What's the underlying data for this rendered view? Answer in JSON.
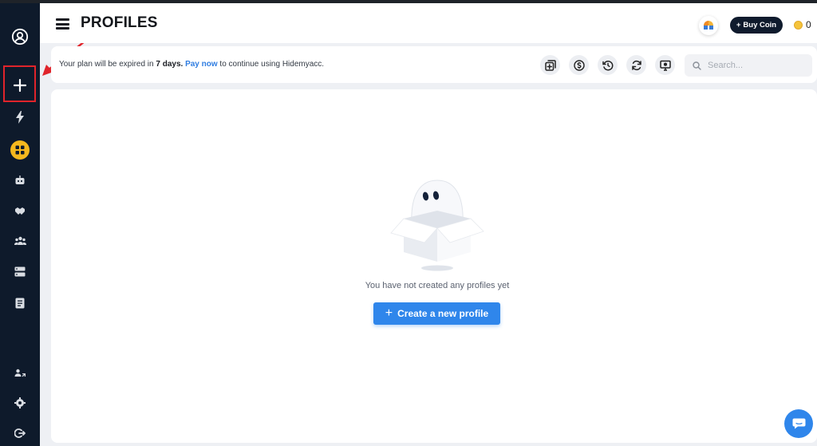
{
  "header": {
    "title": "PROFILES",
    "buy_coin_label": "Buy Coin",
    "buy_coin_plus": "+",
    "coin_count": "0"
  },
  "notice": {
    "part1": "Your plan will be expired in ",
    "days": "7 days.",
    "part2": " ",
    "pay_now": "Pay now",
    "part3": " to continue using Hidemyacc."
  },
  "toolbar": {
    "buttons": [
      "add-to-group-icon",
      "coin-transfer-icon",
      "history-icon",
      "refresh-icon",
      "monitor-icon"
    ]
  },
  "search": {
    "placeholder": "Search...",
    "value": ""
  },
  "sidebar": {
    "items": [
      {
        "icon": "user-circle-icon"
      },
      {
        "icon": "plus-icon"
      },
      {
        "icon": "lightning-icon"
      },
      {
        "icon": "grid-icon",
        "active": true
      },
      {
        "icon": "robot-icon"
      },
      {
        "icon": "handshake-icon"
      },
      {
        "icon": "team-icon"
      },
      {
        "icon": "server-icon"
      },
      {
        "icon": "document-icon"
      },
      {
        "icon": "users-switch-icon"
      },
      {
        "icon": "settings-icon"
      },
      {
        "icon": "logout-icon"
      }
    ]
  },
  "empty_state": {
    "message": "You have not created any profiles yet",
    "create_label": "Create a new profile",
    "create_plus": "+"
  },
  "colors": {
    "sidebar_bg": "#0e1a2b",
    "accent_blue": "#2f86eb",
    "active_yellow": "#f5b81e",
    "highlight_red": "#e0242b"
  }
}
